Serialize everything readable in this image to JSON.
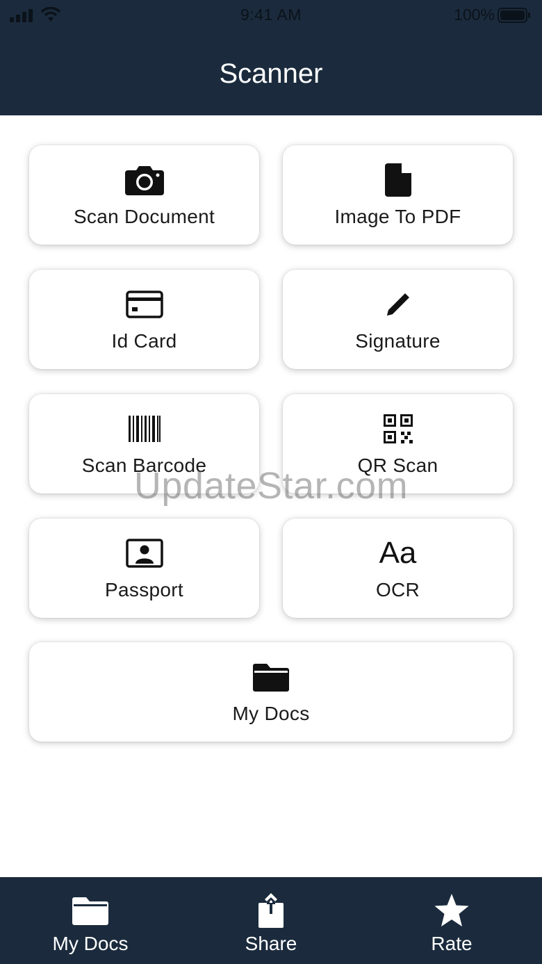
{
  "status_bar": {
    "time": "9:41 AM",
    "battery": "100%"
  },
  "header": {
    "title": "Scanner"
  },
  "tiles": [
    {
      "label": "Scan Document",
      "icon": "camera-icon"
    },
    {
      "label": "Image To PDF",
      "icon": "document-icon"
    },
    {
      "label": "Id Card",
      "icon": "id-card-icon"
    },
    {
      "label": "Signature",
      "icon": "pen-icon"
    },
    {
      "label": "Scan Barcode",
      "icon": "barcode-icon"
    },
    {
      "label": "QR Scan",
      "icon": "qr-code-icon"
    },
    {
      "label": "Passport",
      "icon": "passport-icon"
    },
    {
      "label": "OCR",
      "icon": "text-aa-icon",
      "glyph": "Aa"
    },
    {
      "label": "My Docs",
      "icon": "folder-icon"
    }
  ],
  "watermark": "UpdateStar.com",
  "tabbar": {
    "items": [
      {
        "label": "My Docs",
        "icon": "folder-icon"
      },
      {
        "label": "Share",
        "icon": "share-icon"
      },
      {
        "label": "Rate",
        "icon": "star-icon"
      }
    ]
  },
  "colors": {
    "header_bg": "#1b2b3d",
    "tile_bg": "#ffffff",
    "text": "#1a1a1a"
  }
}
